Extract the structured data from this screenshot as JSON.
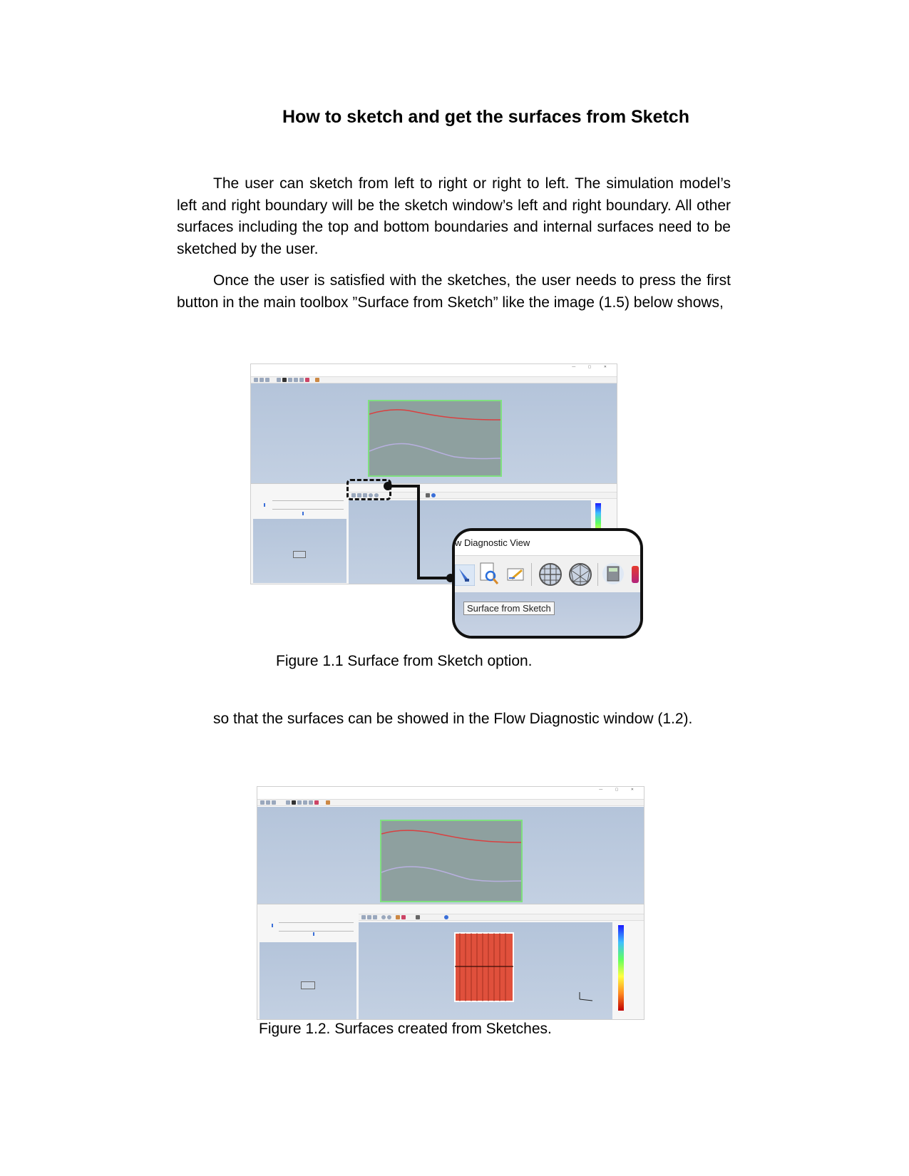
{
  "title": "How to sketch and get the surfaces from Sketch",
  "paragraphs": [
    "The user can sketch from left to right or right to left. The simulation model’s left and right boundary will be the sketch window’s left and right boundary. All other surfaces including the top and bottom boundaries and internal surfaces need to be sketched by the user.",
    "Once the user is satisfied with the sketches, the user needs to press the first button in the main toolbox ”Surface from Sketch” like the image (1.5) below shows,",
    "so that the surfaces can be showed in the Flow Diagnostic window (1.2)."
  ],
  "figure1": {
    "caption": "Figure 1.1 Surface from Sketch option.",
    "callout_title": "w Diagnostic View",
    "tooltip": "Surface from Sketch",
    "icons": [
      "surface-from-sketch-icon",
      "zoom-document-icon",
      "edit-icon",
      "grid-sphere-icon",
      "mesh-sphere-icon",
      "calculator-icon"
    ]
  },
  "figure2": {
    "caption": "Figure 1.2. Surfaces created from Sketches."
  },
  "colors": {
    "sketch_border": "#7fe07f",
    "sketch_fill": "#8ea09f",
    "top_curve": "#d94040",
    "bottom_curve": "#b8b0e0",
    "surface_red": "#e0503c"
  }
}
